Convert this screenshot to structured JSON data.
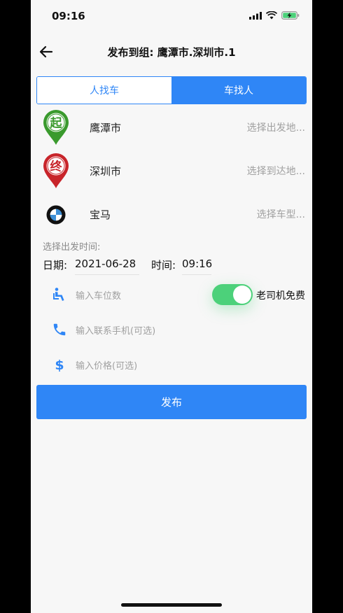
{
  "status": {
    "time": "09:16"
  },
  "nav": {
    "title": "发布到组: 鹰潭市.深圳市.1"
  },
  "tabs": [
    {
      "label": "人找车",
      "active": false
    },
    {
      "label": "车找人",
      "active": true
    }
  ],
  "rows": [
    {
      "icon_char": "起",
      "label": "鹰潭市",
      "hint": "选择出发地..."
    },
    {
      "icon_char": "终",
      "label": "深圳市",
      "hint": "选择到达地..."
    },
    {
      "label": "宝马",
      "hint": "选择车型..."
    }
  ],
  "departure": {
    "section_label": "选择出发时间:",
    "date_label": "日期:",
    "date_value": "2021-06-28",
    "time_label": "时间:",
    "time_value": "09:16"
  },
  "inputs": {
    "seats_placeholder": "输入车位数",
    "phone_placeholder": "输入联系手机(可选)",
    "price_placeholder": "输入价格(可选)"
  },
  "toggle": {
    "label": "老司机免费",
    "on": true
  },
  "publish_label": "发布",
  "colors": {
    "accent": "#2f86f6",
    "green": "#4cd17a",
    "start_pin": "#3a9a2d",
    "end_pin": "#c8242a"
  }
}
